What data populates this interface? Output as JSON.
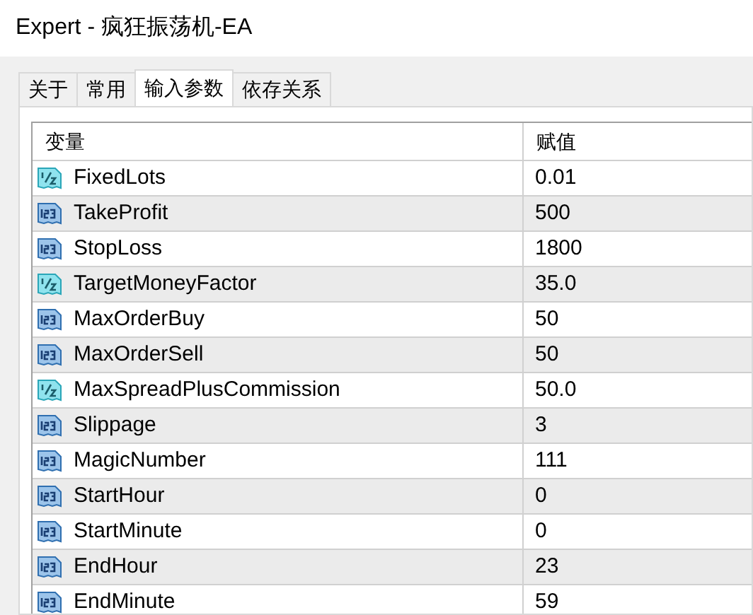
{
  "window": {
    "title": "Expert - 疯狂振荡机-EA"
  },
  "tabs": [
    {
      "label": "关于",
      "selected": false
    },
    {
      "label": "常用",
      "selected": false
    },
    {
      "label": "输入参数",
      "selected": true
    },
    {
      "label": "依存关系",
      "selected": false
    }
  ],
  "table": {
    "columns": [
      "变量",
      "赋值"
    ],
    "rows": [
      {
        "kind": "double",
        "name": "FixedLots",
        "value": "0.01"
      },
      {
        "kind": "int",
        "name": "TakeProfit",
        "value": "500"
      },
      {
        "kind": "int",
        "name": "StopLoss",
        "value": "1800"
      },
      {
        "kind": "double",
        "name": "TargetMoneyFactor",
        "value": "35.0"
      },
      {
        "kind": "int",
        "name": "MaxOrderBuy",
        "value": "50"
      },
      {
        "kind": "int",
        "name": "MaxOrderSell",
        "value": "50"
      },
      {
        "kind": "double",
        "name": "MaxSpreadPlusCommission",
        "value": "50.0"
      },
      {
        "kind": "int",
        "name": "Slippage",
        "value": "3"
      },
      {
        "kind": "int",
        "name": "MagicNumber",
        "value": "111"
      },
      {
        "kind": "int",
        "name": "StartHour",
        "value": "0"
      },
      {
        "kind": "int",
        "name": "StartMinute",
        "value": "0"
      },
      {
        "kind": "int",
        "name": "EndHour",
        "value": "23"
      },
      {
        "kind": "int",
        "name": "EndMinute",
        "value": "59"
      }
    ]
  }
}
